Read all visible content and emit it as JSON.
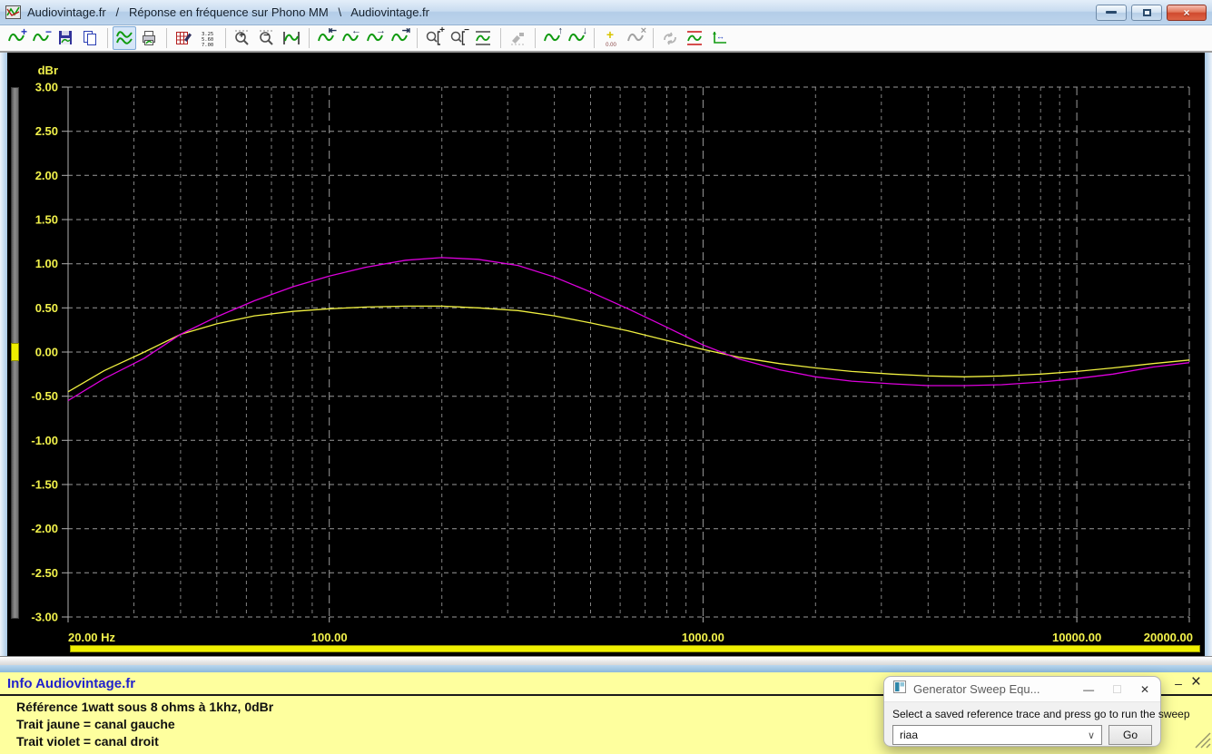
{
  "window": {
    "title": "Audiovintage.fr   /   Réponse en fréquence sur Phono MM   \\   Audiovintage.fr",
    "controls": {
      "minimize": "minimize",
      "restore": "restore",
      "close": "×"
    }
  },
  "toolbar": {
    "groups": [
      [
        {
          "name": "add-trace-icon",
          "base": "wave",
          "glyph": "+",
          "glyph_color": "#2233bb",
          "glyph_size": 12
        },
        {
          "name": "subtract-trace-icon",
          "base": "wave",
          "glyph": "−",
          "glyph_color": "#2233bb",
          "glyph_size": 12
        },
        {
          "name": "save-trace-icon",
          "base": "save"
        },
        {
          "name": "copy-graph-icon",
          "base": "copy"
        }
      ],
      [
        {
          "name": "show-graph-icon",
          "base": "wave2",
          "selected": true
        },
        {
          "name": "print-graph-icon",
          "base": "printer"
        }
      ],
      [
        {
          "name": "edit-info-icon",
          "base": "table"
        },
        {
          "name": "show-values-icon",
          "base": "numbers"
        }
      ],
      [
        {
          "name": "zoom-in-icon",
          "base": "zoom",
          "glyph": "+",
          "glyph_pos": "c",
          "glyph_color": "#222",
          "glyph_size": 10
        },
        {
          "name": "zoom-out-icon",
          "base": "zoom",
          "glyph": "−",
          "glyph_pos": "c",
          "glyph_color": "#222",
          "glyph_size": 10
        },
        {
          "name": "fit-trace-icon",
          "base": "wavefit"
        }
      ],
      [
        {
          "name": "scroll-start-icon",
          "base": "wave",
          "glyph": "⇤",
          "glyph_color": "#223355",
          "glyph_size": 11
        },
        {
          "name": "scroll-left-icon",
          "base": "wave",
          "glyph": "←",
          "glyph_color": "#223355",
          "glyph_size": 11
        },
        {
          "name": "scroll-right-icon",
          "base": "wave",
          "glyph": "→",
          "glyph_color": "#223355",
          "glyph_size": 11
        },
        {
          "name": "scroll-end-icon",
          "base": "wave",
          "glyph": "⇥",
          "glyph_color": "#223355",
          "glyph_size": 11
        }
      ],
      [
        {
          "name": "zoom-x-in-icon",
          "base": "zoombracket",
          "glyph": "+",
          "glyph_color": "#222",
          "glyph_size": 10
        },
        {
          "name": "zoom-x-out-icon",
          "base": "zoombracket",
          "glyph": "−",
          "glyph_color": "#222",
          "glyph_size": 10
        },
        {
          "name": "autoscale-icon",
          "base": "wavelimits",
          "color": "#555555"
        }
      ],
      [
        {
          "name": "tool-icon-disabled",
          "base": "grayed",
          "disabled": true
        }
      ],
      [
        {
          "name": "shift-up-icon",
          "base": "wave",
          "glyph": "↑",
          "glyph_color": "#223355",
          "glyph_size": 11
        },
        {
          "name": "shift-down-icon",
          "base": "wave",
          "glyph": "↓",
          "glyph_color": "#223355",
          "glyph_size": 11
        }
      ],
      [
        {
          "name": "add-marker-icon",
          "base": "marker",
          "marker_label": "0.00"
        },
        {
          "name": "clear-marker-icon",
          "base": "wave",
          "glyph": "×",
          "glyph_color": "#9a9a9a",
          "glyph_size": 11,
          "disabled": true
        }
      ],
      [
        {
          "name": "refresh-icon-disabled",
          "base": "grayed2",
          "disabled": true
        },
        {
          "name": "limits-icon",
          "base": "wavelimits",
          "color": "#cc2222"
        },
        {
          "name": "axis-setup-icon",
          "base": "axis"
        }
      ]
    ]
  },
  "chart_data": {
    "type": "line",
    "x_scale": "log",
    "xlim": [
      20,
      20000
    ],
    "ylim": [
      -3,
      3
    ],
    "ytick_step": 0.5,
    "ylabel": "dBr",
    "grid": true,
    "grid_color": "#9a9a9a",
    "axis_color": "#f2f24b",
    "background": "#000000",
    "xticks": [
      {
        "f": 20,
        "label": "20.00 Hz"
      },
      {
        "f": 100,
        "label": "100.00"
      },
      {
        "f": 1000,
        "label": "1000.00"
      },
      {
        "f": 10000,
        "label": "10000.00"
      },
      {
        "f": 20000,
        "label": "20000.00"
      }
    ],
    "freqs": [
      20,
      25,
      32,
      40,
      50,
      63,
      80,
      100,
      125,
      160,
      200,
      250,
      320,
      400,
      500,
      630,
      800,
      1000,
      1250,
      1600,
      2000,
      2500,
      3200,
      4000,
      5000,
      6300,
      8000,
      10000,
      12500,
      16000,
      20000
    ],
    "series": [
      {
        "name": "canal gauche (trait jaune)",
        "color": "#f0f040",
        "values": [
          -0.45,
          -0.21,
          0.0,
          0.2,
          0.32,
          0.41,
          0.46,
          0.49,
          0.51,
          0.52,
          0.52,
          0.5,
          0.47,
          0.41,
          0.33,
          0.24,
          0.13,
          0.03,
          -0.06,
          -0.13,
          -0.18,
          -0.22,
          -0.25,
          -0.27,
          -0.28,
          -0.27,
          -0.25,
          -0.22,
          -0.18,
          -0.13,
          -0.09
        ]
      },
      {
        "name": "canal droit (trait violet)",
        "color": "#dd00dd",
        "values": [
          -0.55,
          -0.3,
          -0.07,
          0.2,
          0.4,
          0.58,
          0.74,
          0.86,
          0.96,
          1.04,
          1.07,
          1.05,
          0.98,
          0.85,
          0.68,
          0.49,
          0.28,
          0.08,
          -0.08,
          -0.2,
          -0.28,
          -0.33,
          -0.36,
          -0.38,
          -0.38,
          -0.37,
          -0.34,
          -0.3,
          -0.25,
          -0.17,
          -0.12
        ]
      }
    ]
  },
  "info_panel": {
    "header": "Info Audiovintage.fr",
    "lines": [
      "Référence 1watt sous 8 ohms à 1khz, 0dBr",
      "Trait jaune = canal gauche",
      "Trait violet = canal droit"
    ],
    "minimize_glyph": "–",
    "close_glyph": "×"
  },
  "dialog": {
    "title": "Generator Sweep Equ...",
    "minimize_glyph": "—",
    "maximize_glyph": "☐",
    "close_glyph": "✕",
    "message": "Select a saved reference trace and press go to run the sweep",
    "combo_value": "riaa",
    "combo_chevron": "∨",
    "go_label": "Go"
  }
}
